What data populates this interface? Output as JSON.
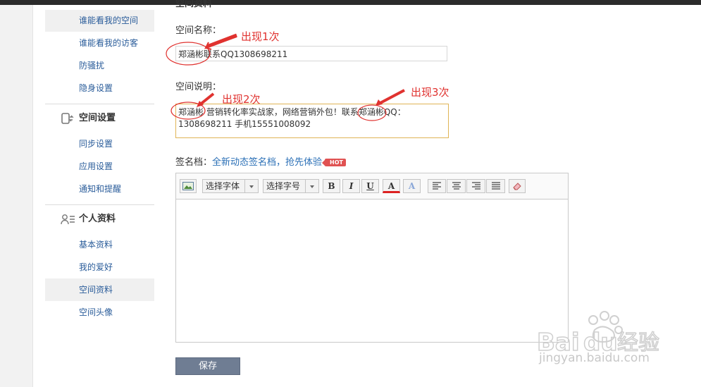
{
  "sidebar": {
    "items_top": [
      {
        "label": "谁能看我的空间",
        "active": true
      },
      {
        "label": "谁能看我的访客",
        "active": false
      },
      {
        "label": "防骚扰",
        "active": false
      },
      {
        "label": "隐身设置",
        "active": false
      }
    ],
    "group_space": {
      "title": "空间设置",
      "icon": "phone-sync-icon"
    },
    "items_space": [
      {
        "label": "同步设置"
      },
      {
        "label": "应用设置"
      },
      {
        "label": "通知和提醒"
      }
    ],
    "group_profile": {
      "title": "个人资料",
      "icon": "person-list-icon"
    },
    "items_profile": [
      {
        "label": "基本资料",
        "active": false
      },
      {
        "label": "我的爱好",
        "active": false
      },
      {
        "label": "空间资料",
        "active": true
      },
      {
        "label": "空间头像",
        "active": false
      }
    ]
  },
  "main": {
    "section_title": "空间资料",
    "space_name": {
      "label": "空间名称：",
      "value": "郑涵彬联系QQ1308698211"
    },
    "space_desc": {
      "label": "空间说明：",
      "line1": "郑涵彬 营销转化率实战家，网络营销外包！联系郑涵彬QQ：",
      "line2": "1308698211 手机15551008092"
    },
    "signature": {
      "label": "签名档：",
      "link": "全新动态签名档，抢先体验",
      "badge": "HOT"
    },
    "editor": {
      "font_select": "选择字体",
      "size_select": "选择字号",
      "bold": "B",
      "italic": "I",
      "underline": "U",
      "font_color": "A",
      "highlight": "A"
    },
    "save_label": "保存"
  },
  "annotations": {
    "first": "出现1次",
    "second": "出现2次",
    "third": "出现3次",
    "color": "#e0322f"
  },
  "watermark": {
    "brand": "Baidu经验",
    "url": "jingyan.baidu.com"
  }
}
